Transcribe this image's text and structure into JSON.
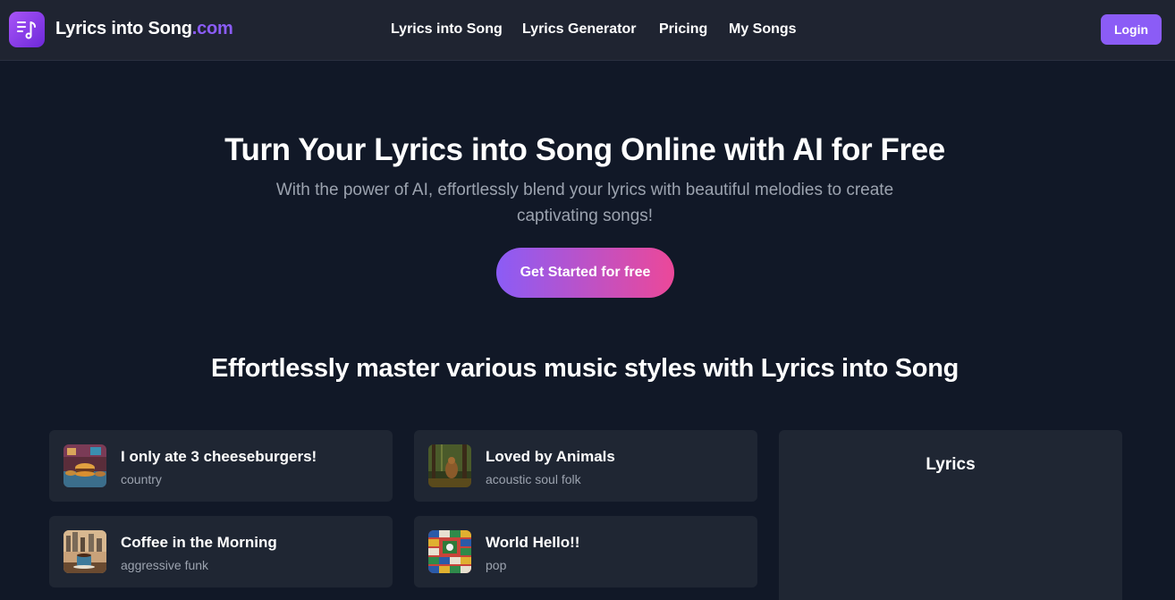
{
  "header": {
    "brand_main": "Lyrics into Song",
    "brand_suffix": ".com",
    "logo_icon": "music-note-list-icon",
    "nav": [
      {
        "label": "Lyrics into Song"
      },
      {
        "label": "Lyrics Generator"
      },
      {
        "label": "Pricing"
      },
      {
        "label": "My Songs"
      }
    ],
    "login_label": "Login"
  },
  "hero": {
    "title": "Turn Your Lyrics into Song Online with AI for Free",
    "subtitle": "With the power of AI, effortlessly blend your lyrics with beautiful melodies to create captivating songs!",
    "cta_label": "Get Started for free"
  },
  "styles_section": {
    "title": "Effortlessly master various music styles with Lyrics into Song",
    "songs": [
      {
        "title": "I only ate 3 cheeseburgers!",
        "genre": "country",
        "thumb": "cheeseburger-diner-thumbnail"
      },
      {
        "title": "Loved by Animals",
        "genre": "acoustic soul folk",
        "thumb": "forest-animal-thumbnail"
      },
      {
        "title": "Coffee in the Morning",
        "genre": "aggressive funk",
        "thumb": "coffee-cityscape-thumbnail"
      },
      {
        "title": "World Hello!!",
        "genre": "pop",
        "thumb": "world-flags-thumbnail"
      }
    ],
    "lyrics_panel_title": "Lyrics"
  },
  "colors": {
    "background": "#111827",
    "header": "#1f2431",
    "accent": "#8b5cf6",
    "cta_gradient_end": "#ec4899",
    "card": "#1f2633",
    "muted_text": "#9ca3af"
  }
}
